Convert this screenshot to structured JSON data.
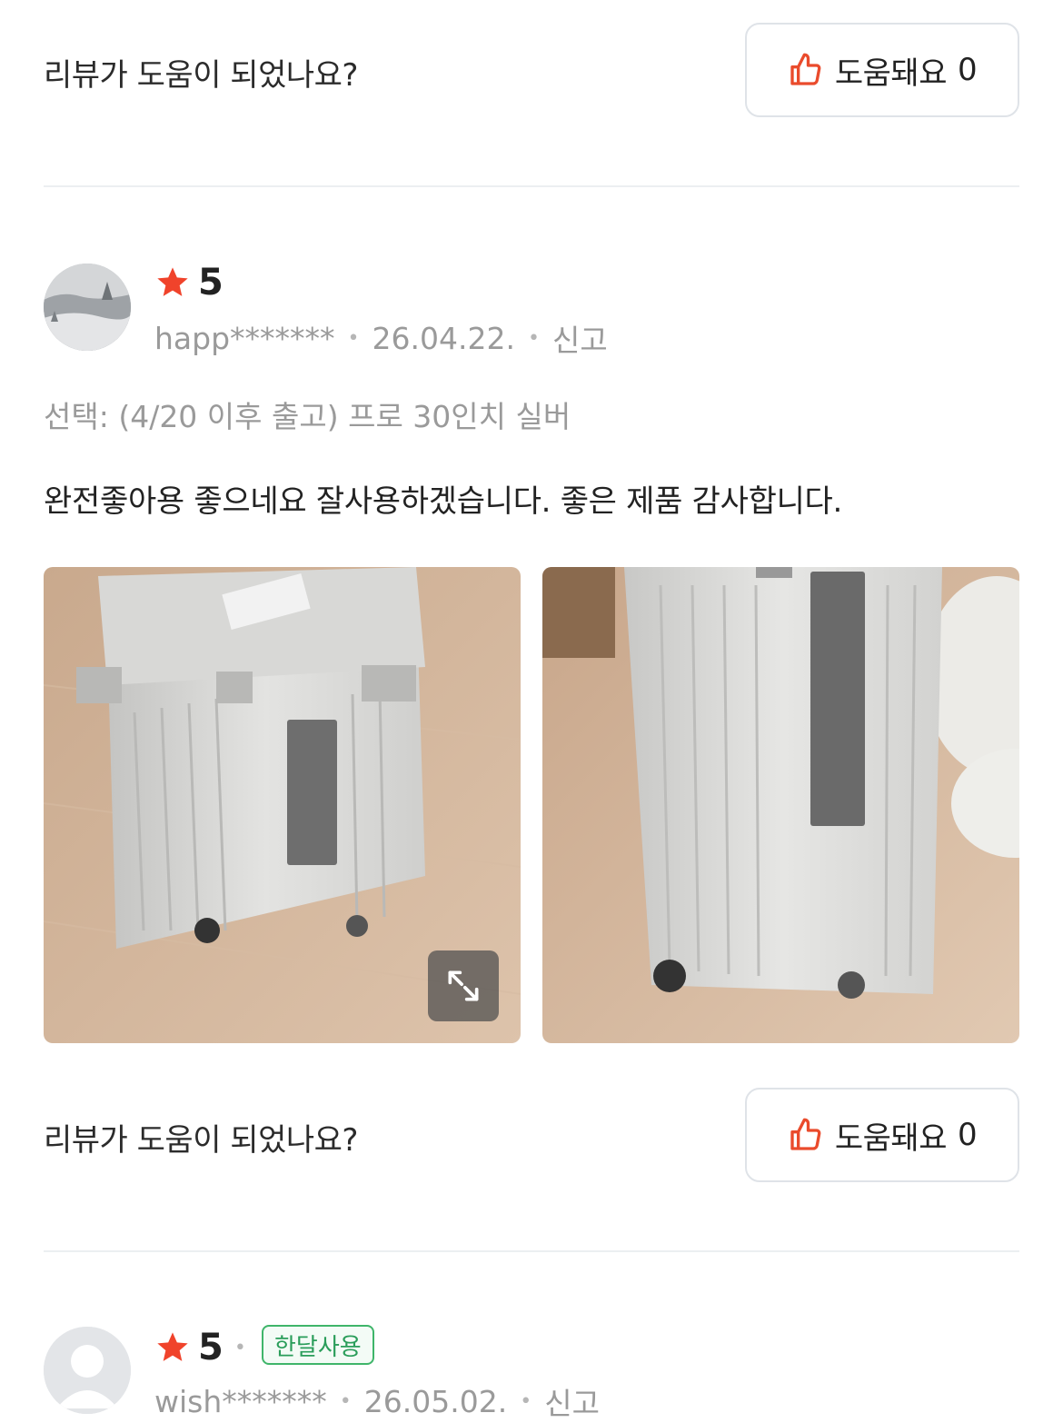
{
  "helpful_1": {
    "question": "리뷰가 도움이 되었나요?",
    "button_label": "도움돼요",
    "count": "0"
  },
  "review_1": {
    "rating": "5",
    "username": "happ*******",
    "date": "26.04.22.",
    "report": "신고",
    "option": "선택: (4/20 이후 출고) 프로 30인치 실버",
    "text": "완전좋아용 좋으네요 잘사용하겠습니다. 좋은 제품 감사합니다."
  },
  "helpful_2": {
    "question": "리뷰가 도움이 되었나요?",
    "button_label": "도움돼요",
    "count": "0"
  },
  "review_2": {
    "rating": "5",
    "badge": "한달사용",
    "username": "wish*******",
    "date": "26.05.02.",
    "report": "신고"
  },
  "colors": {
    "star": "#f0432b",
    "badge_green": "#2a9d5a",
    "thumb": "#ea4b2c"
  },
  "icons": {
    "thumb": "thumbs-up-icon",
    "star": "star-icon",
    "expand": "expand-icon"
  }
}
